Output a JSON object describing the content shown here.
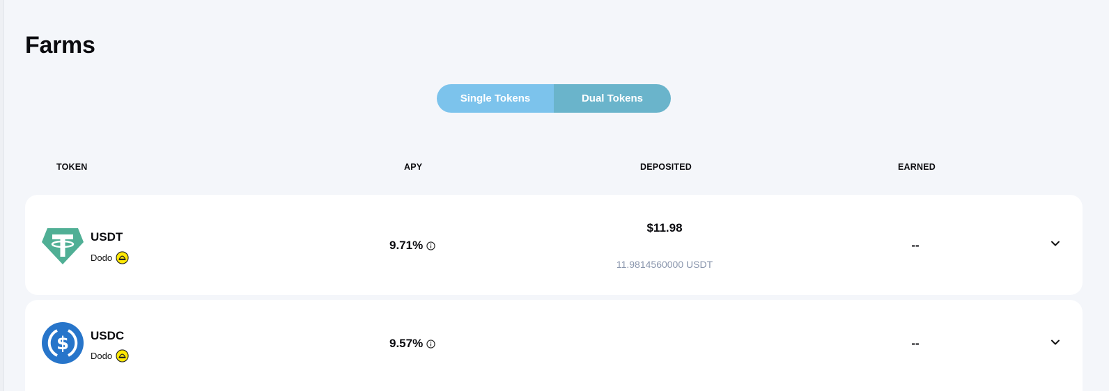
{
  "page": {
    "title": "Farms"
  },
  "toggle": {
    "single_label": "Single Tokens",
    "dual_label": "Dual Tokens"
  },
  "table": {
    "headers": {
      "token": "TOKEN",
      "apy": "APY",
      "deposited": "DEPOSITED",
      "earned": "EARNED"
    },
    "rows": [
      {
        "token": "USDT",
        "source": "Dodo",
        "apy": "9.71%",
        "deposited_usd": "$11.98",
        "deposited_amount": "11.9814560000 USDT",
        "earned": "--",
        "icon": "tether-icon"
      },
      {
        "token": "USDC",
        "source": "Dodo",
        "apy": "9.57%",
        "deposited_usd": "",
        "deposited_amount": "",
        "earned": "--",
        "icon": "usdc-icon"
      }
    ]
  },
  "colors": {
    "background": "#f4f6fa",
    "toggle_single": "#7cc3ec",
    "toggle_dual": "#6ab4cb",
    "tether_green": "#50af95",
    "usdc_blue": "#2775ca",
    "dodo_yellow": "#ffe804",
    "muted_text": "#8a96ad"
  }
}
